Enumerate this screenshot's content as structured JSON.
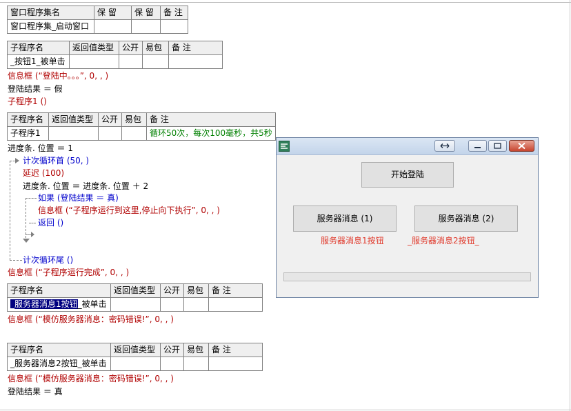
{
  "window_set_table": {
    "headers": [
      "窗口程序集名",
      "保 留",
      "保 留",
      "备 注"
    ],
    "row": [
      "窗口程序集_启动窗口",
      "",
      "",
      ""
    ]
  },
  "sub1": {
    "headers": [
      "子程序名",
      "返回值类型",
      "公开",
      "易包",
      "备 注"
    ],
    "row": [
      "_按钮1_被单击",
      "",
      "",
      "",
      ""
    ],
    "lines": [
      "信息框 (“登陆中。。。”, 0, , )",
      "登陆结果 ＝ 假",
      "子程序1 ()"
    ]
  },
  "sub2": {
    "headers": [
      "子程序名",
      "返回值类型",
      "公开",
      "易包",
      "备 注"
    ],
    "row": [
      "子程序1",
      "",
      "",
      "",
      "循环50次，每次100毫秒，共5秒"
    ],
    "lines": {
      "l1": "进度条. 位置 ＝ 1",
      "l2": "计次循环首 (50, )",
      "l3": "延迟 (100)",
      "l4": "进度条. 位置 ＝ 进度条. 位置 ＋ 2",
      "l5": "如果 (登陆结果 ＝ 真)",
      "l6": "信息框 (“子程序运行到这里,停止向下执行”, 0, , )",
      "l7": "返回 ()",
      "l8": "计次循环尾 ()",
      "l9": "信息框 (“子程序运行完成”, 0, , )"
    }
  },
  "sub3": {
    "headers": [
      "子程序名",
      "返回值类型",
      "公开",
      "易包",
      "备 注"
    ],
    "row_selected": "_服务器消息1按钮",
    "row_rest": "_被单击",
    "line": "信息框 (“模仿服务器消息：密码错误!”, 0, , )"
  },
  "sub4": {
    "headers": [
      "子程序名",
      "返回值类型",
      "公开",
      "易包",
      "备 注"
    ],
    "row": [
      "_服务器消息2按钮_被单击",
      "",
      "",
      "",
      ""
    ],
    "lines": [
      "信息框 (“模仿服务器消息：密码错误!”, 0, , )",
      "登陆结果 ＝ 真"
    ]
  },
  "window": {
    "title_icons": [
      "app-icon",
      "resize-arrows-icon",
      "minimize-icon",
      "maximize-icon",
      "close-icon"
    ],
    "start_button": "开始登陆",
    "server_btn1": "服务器消息 (1)",
    "server_btn2": "服务器消息 (2)",
    "label1": "服务器消息1按钮",
    "label2": "_服务器消息2按钮_",
    "progress": 0,
    "accent_red": "#e0392b"
  }
}
